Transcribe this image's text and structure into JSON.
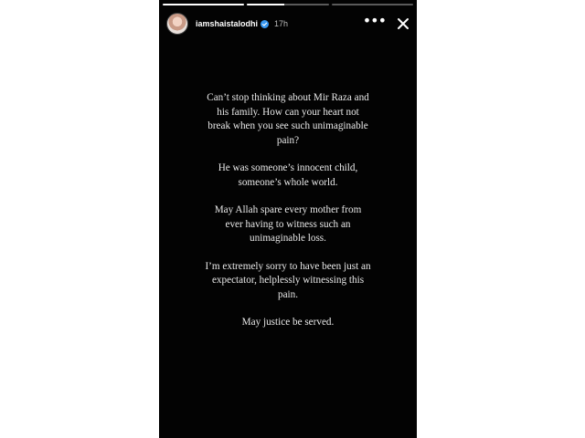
{
  "story": {
    "username": "iamshaistalodhi",
    "time": "17h",
    "progress": [
      1,
      0.45,
      0
    ],
    "paragraphs": [
      "Can’t stop thinking about Mir Raza and his family. How can your heart not break when you see such unimaginable pain?",
      "He was someone’s innocent child, someone’s whole world.",
      "May Allah spare every mother from ever having to witness such an unimaginable loss.",
      "I’m extremely sorry to have been just an expectator, helplessly witnessing this pain.",
      "May justice be served."
    ]
  },
  "icons": {
    "verified": "verified-badge-icon",
    "more": "more-options-icon",
    "close": "close-icon"
  },
  "colors": {
    "background": "#030303",
    "text": "#e9e9e9",
    "verified": "#3897f0"
  }
}
